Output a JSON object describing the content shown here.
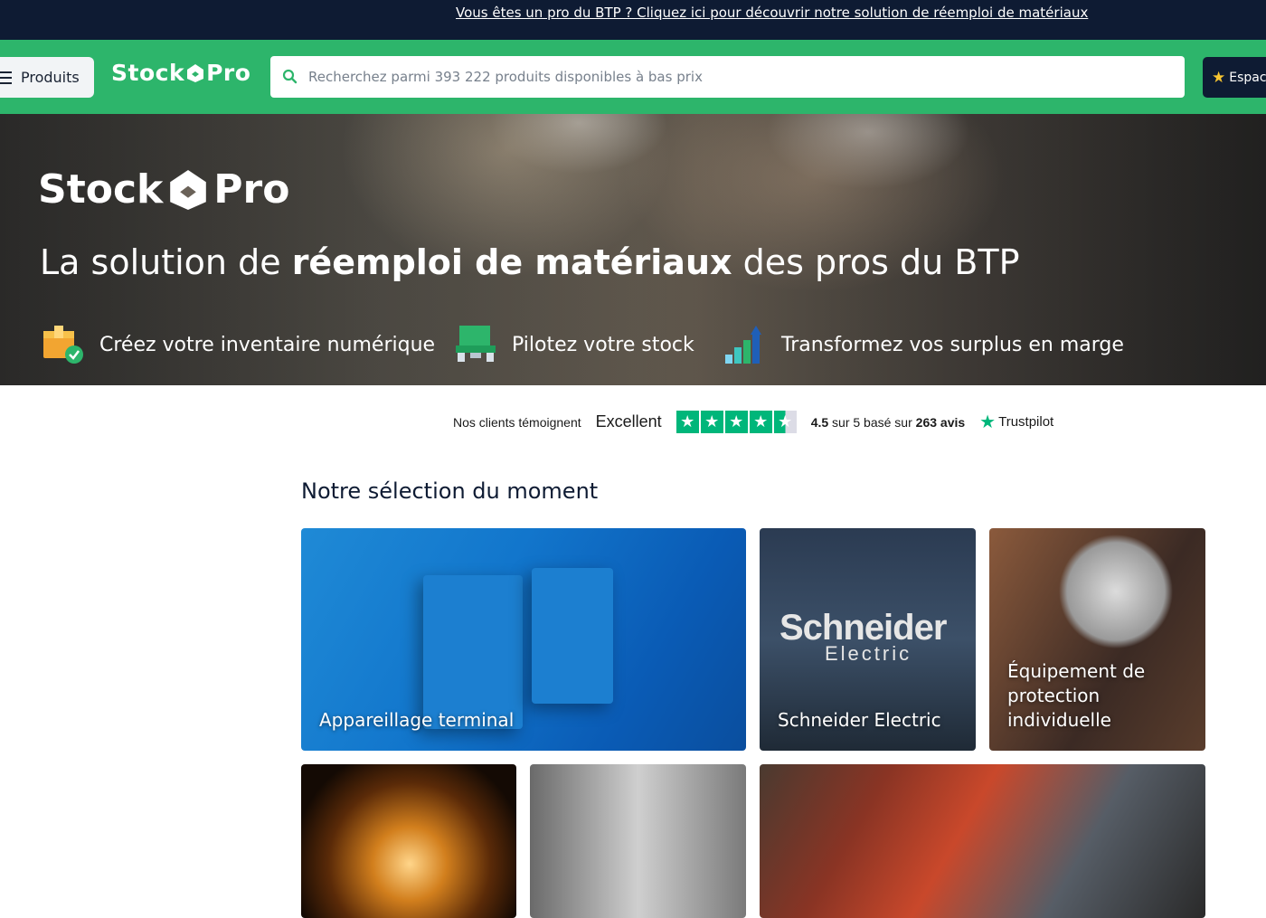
{
  "top_banner": {
    "text": "Vous êtes un pro du BTP ? Cliquez ici pour découvrir notre solution de réemploi de matériaux"
  },
  "nav": {
    "products_label": "Produits",
    "logo_left": "Stock",
    "logo_right": "Pro",
    "search_placeholder": "Recherchez parmi 393 222 produits disponibles à bas prix",
    "espace_label": "Espac"
  },
  "hero": {
    "logo_left": "Stock",
    "logo_right": "Pro",
    "title_pre": "La solution de ",
    "title_bold": "réemploi de matériaux",
    "title_post": " des pros du BTP",
    "features": [
      {
        "icon": "inventory-box-icon",
        "label": "Créez votre inventaire numérique"
      },
      {
        "icon": "stock-pallet-icon",
        "label": "Pilotez votre stock"
      },
      {
        "icon": "growth-chart-icon",
        "label": "Transformez vos surplus en marge"
      }
    ]
  },
  "trust": {
    "intro": "Nos clients témoignent",
    "rating_word": "Excellent",
    "score_pre": "4.5",
    "score_mid": " sur 5 basé sur ",
    "reviews": "263 avis",
    "brand": "Trustpilot",
    "stars": 4.5
  },
  "selection": {
    "title": "Notre sélection du moment",
    "cards": [
      {
        "label": "Appareillage terminal"
      },
      {
        "label": "Schneider Electric",
        "logo_top": "Schneider",
        "logo_bottom": "Electric"
      },
      {
        "label": "Équipement de protection individuelle"
      },
      {
        "label": ""
      },
      {
        "label": ""
      },
      {
        "label": ""
      }
    ]
  }
}
